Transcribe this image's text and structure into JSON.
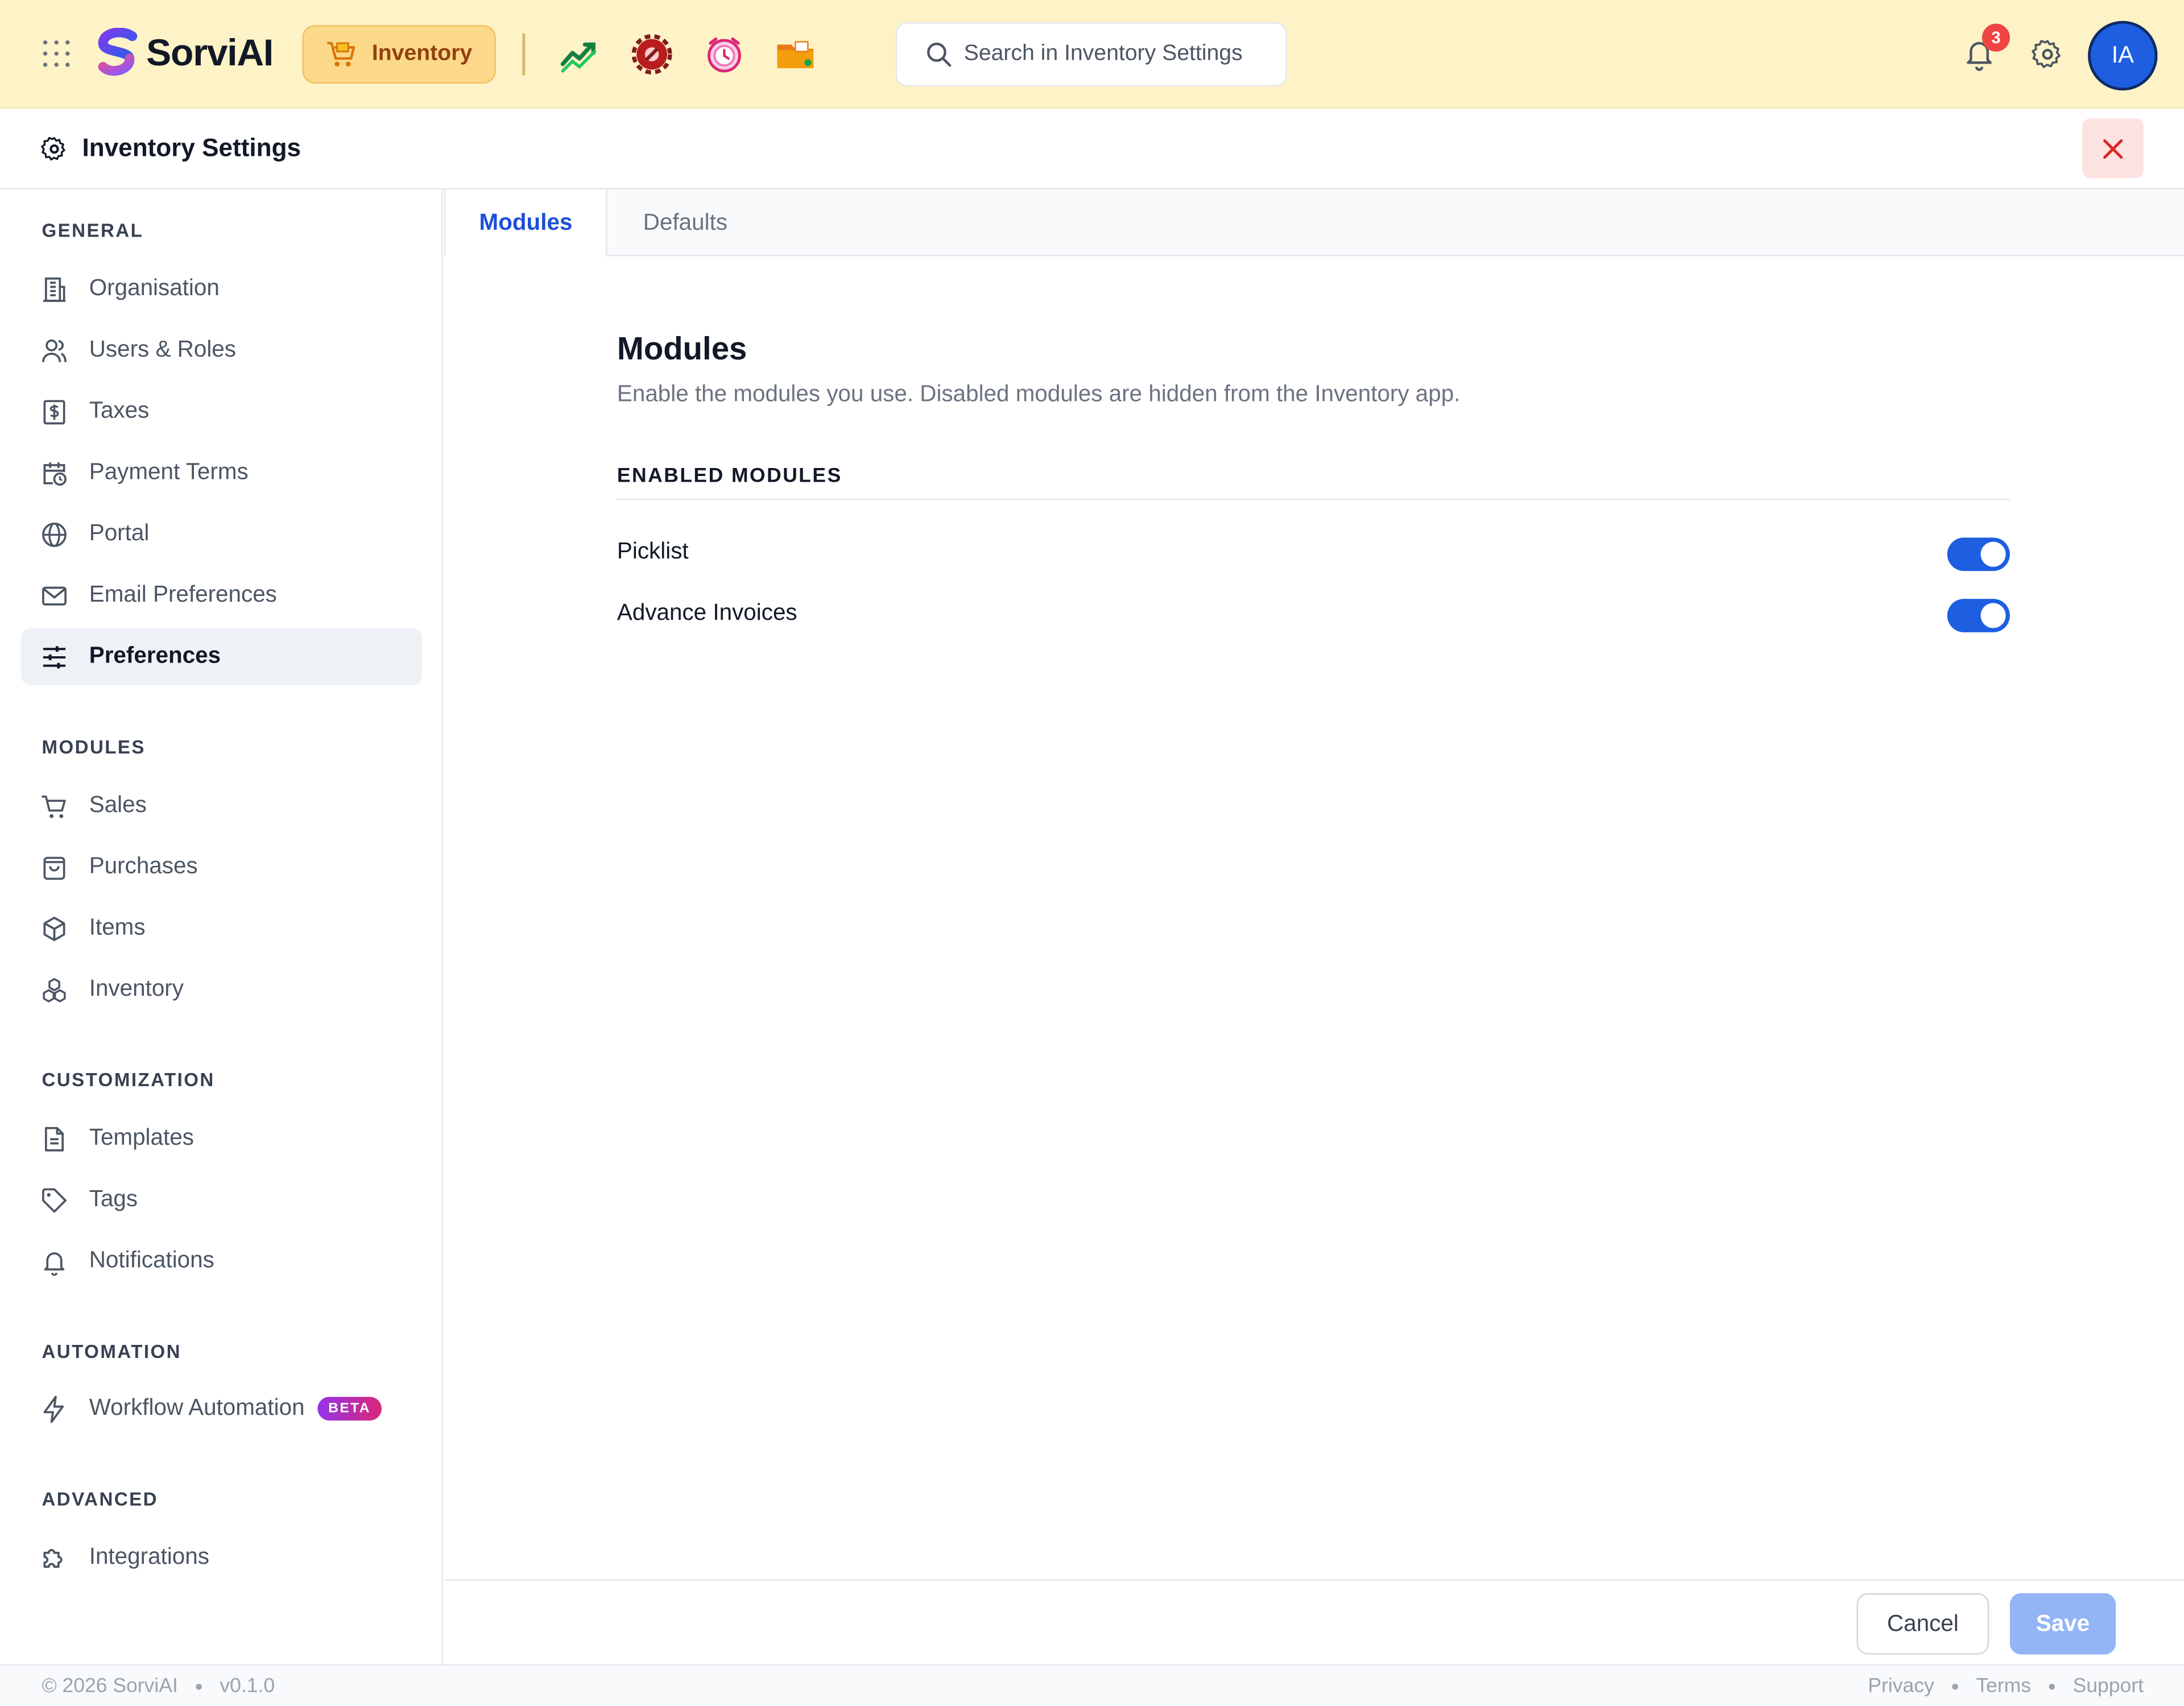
{
  "brand": {
    "name": "SorviAI",
    "accent": "#1d5fe0",
    "topbar_bg": "#fef3c7"
  },
  "app_switcher": {
    "current_app": "Inventory"
  },
  "app_icons": [
    "analytics-icon",
    "settings-tools-icon",
    "alarm-clock-icon",
    "folder-icon"
  ],
  "search": {
    "placeholder": "Search in Inventory Settings"
  },
  "notifications": {
    "count": "3"
  },
  "user": {
    "initials": "IA"
  },
  "settings": {
    "title": "Inventory Settings"
  },
  "sidebar": {
    "sections": [
      {
        "title": "GENERAL",
        "items": [
          {
            "label": "Organisation",
            "icon": "building-icon"
          },
          {
            "label": "Users & Roles",
            "icon": "users-icon"
          },
          {
            "label": "Taxes",
            "icon": "dollar-receipt-icon"
          },
          {
            "label": "Payment Terms",
            "icon": "calendar-clock-icon"
          },
          {
            "label": "Portal",
            "icon": "globe-icon"
          },
          {
            "label": "Email Preferences",
            "icon": "mail-icon"
          },
          {
            "label": "Preferences",
            "icon": "sliders-icon",
            "active": true
          }
        ]
      },
      {
        "title": "MODULES",
        "items": [
          {
            "label": "Sales",
            "icon": "cart-icon"
          },
          {
            "label": "Purchases",
            "icon": "shopping-bag-icon"
          },
          {
            "label": "Items",
            "icon": "box-icon"
          },
          {
            "label": "Inventory",
            "icon": "boxes-icon"
          }
        ]
      },
      {
        "title": "CUSTOMIZATION",
        "items": [
          {
            "label": "Templates",
            "icon": "document-icon"
          },
          {
            "label": "Tags",
            "icon": "tag-icon"
          },
          {
            "label": "Notifications",
            "icon": "bell-icon"
          }
        ]
      },
      {
        "title": "AUTOMATION",
        "items": [
          {
            "label": "Workflow Automation",
            "icon": "lightning-icon",
            "badge": "BETA"
          }
        ]
      },
      {
        "title": "ADVANCED",
        "items": [
          {
            "label": "Integrations",
            "icon": "puzzle-icon"
          }
        ]
      }
    ]
  },
  "tabs": [
    {
      "label": "Modules",
      "active": true
    },
    {
      "label": "Defaults",
      "active": false
    }
  ],
  "main": {
    "title": "Modules",
    "description": "Enable the modules you use. Disabled modules are hidden from the Inventory app.",
    "section_title": "ENABLED MODULES",
    "modules": [
      {
        "label": "Picklist",
        "enabled": true
      },
      {
        "label": "Advance Invoices",
        "enabled": true
      }
    ]
  },
  "actions": {
    "cancel_label": "Cancel",
    "save_label": "Save"
  },
  "footer": {
    "copyright": "© 2026 SorviAI",
    "version": "v0.1.0",
    "links": [
      "Privacy",
      "Terms",
      "Support"
    ]
  }
}
